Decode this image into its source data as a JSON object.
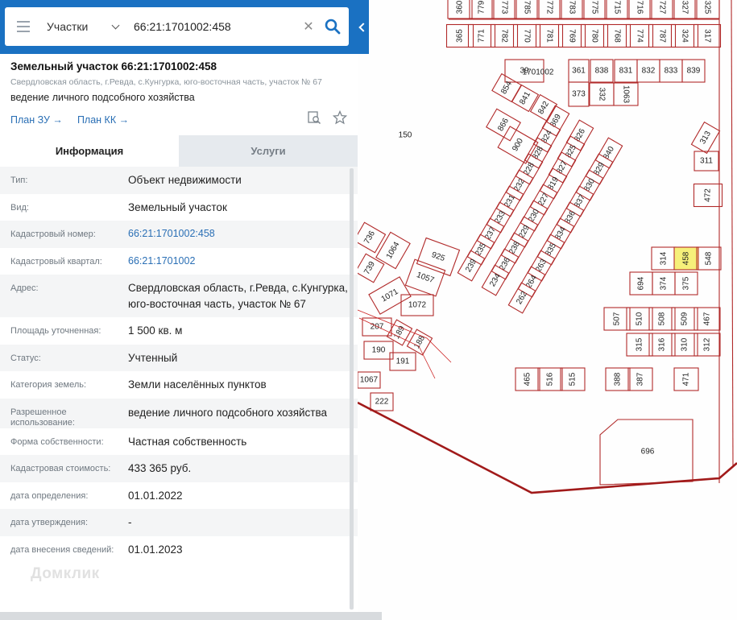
{
  "search": {
    "type_label": "Участки",
    "query": "66:21:1701002:458"
  },
  "header": {
    "title": "Земельный участок 66:21:1701002:458",
    "address_sub": "Свердловская область, г.Ревда, с.Кунгурка, юго-восточная часть, участок № 67",
    "use_sub": "ведение личного подсобного хозяйства",
    "link_plan_zu": "План ЗУ →",
    "link_plan_kk": "План КК →"
  },
  "tabs": {
    "info": "Информация",
    "services": "Услуги"
  },
  "details": [
    {
      "label": "Тип:",
      "value": "Объект недвижимости"
    },
    {
      "label": "Вид:",
      "value": "Земельный участок"
    },
    {
      "label": "Кадастровый номер:",
      "value": "66:21:1701002:458"
    },
    {
      "label": "Кадастровый квартал:",
      "value": "66:21:1701002"
    },
    {
      "label": "Адрес:",
      "value": "Свердловская область, г.Ревда, с.Кунгурка, юго-восточная часть, участок № 67"
    },
    {
      "label": "Площадь уточненная:",
      "value": "1 500 кв. м"
    },
    {
      "label": "Статус:",
      "value": "Учтенный"
    },
    {
      "label": "Категория земель:",
      "value": "Земли населённых пунктов"
    },
    {
      "label": "Разрешенное использование:",
      "value": "ведение личного подсобного хозяйства"
    },
    {
      "label": "Форма собственности:",
      "value": "Частная собственность"
    },
    {
      "label": "Кадастровая стоимость:",
      "value": "433 365 руб."
    },
    {
      "label": "дата определения:",
      "value": "01.01.2022"
    },
    {
      "label": "дата утверждения:",
      "value": "-"
    },
    {
      "label": "дата внесения сведений:",
      "value": "01.01.2023"
    }
  ],
  "watermark": "Домклик",
  "map": {
    "quarter_label": "1701002",
    "highlight_color": "#f6f07a",
    "boundary_color": "#b12a2a",
    "parcels": [
      {
        "id": "360"
      },
      {
        "id": "779"
      },
      {
        "id": "773"
      },
      {
        "id": "785"
      },
      {
        "id": "772"
      },
      {
        "id": "783"
      },
      {
        "id": "775"
      },
      {
        "id": "715"
      },
      {
        "id": "716"
      },
      {
        "id": "727"
      },
      {
        "id": "327"
      },
      {
        "id": "325"
      },
      {
        "id": "365"
      },
      {
        "id": "771"
      },
      {
        "id": "782"
      },
      {
        "id": "770"
      },
      {
        "id": "781"
      },
      {
        "id": "769"
      },
      {
        "id": "780"
      },
      {
        "id": "768"
      },
      {
        "id": "774"
      },
      {
        "id": "787"
      },
      {
        "id": "324"
      },
      {
        "id": "317"
      },
      {
        "id": "39"
      },
      {
        "id": "361"
      },
      {
        "id": "838"
      },
      {
        "id": "831"
      },
      {
        "id": "832"
      },
      {
        "id": "833"
      },
      {
        "id": "839"
      },
      {
        "id": "373"
      },
      {
        "id": "332"
      },
      {
        "id": "1063"
      },
      {
        "id": "854"
      },
      {
        "id": "841"
      },
      {
        "id": "842"
      },
      {
        "id": "866"
      },
      {
        "id": "900"
      },
      {
        "id": "869"
      },
      {
        "id": "826"
      },
      {
        "id": "824"
      },
      {
        "id": "825"
      },
      {
        "id": "828"
      },
      {
        "id": "827"
      },
      {
        "id": "228"
      },
      {
        "id": "819"
      },
      {
        "id": "840"
      },
      {
        "id": "829"
      },
      {
        "id": "830"
      },
      {
        "id": "232"
      },
      {
        "id": "227"
      },
      {
        "id": "231"
      },
      {
        "id": "230"
      },
      {
        "id": "837"
      },
      {
        "id": "836"
      },
      {
        "id": "233"
      },
      {
        "id": "229"
      },
      {
        "id": "834"
      },
      {
        "id": "237"
      },
      {
        "id": "238"
      },
      {
        "id": "835"
      },
      {
        "id": "235"
      },
      {
        "id": "236"
      },
      {
        "id": "263"
      },
      {
        "id": "239"
      },
      {
        "id": "234"
      },
      {
        "id": "264"
      },
      {
        "id": "262"
      },
      {
        "id": "150"
      },
      {
        "id": "313"
      },
      {
        "id": "311"
      },
      {
        "id": "472"
      },
      {
        "id": "314"
      },
      {
        "id": "458"
      },
      {
        "id": "548"
      },
      {
        "id": "694"
      },
      {
        "id": "374"
      },
      {
        "id": "375"
      },
      {
        "id": "507"
      },
      {
        "id": "510"
      },
      {
        "id": "508"
      },
      {
        "id": "509"
      },
      {
        "id": "467"
      },
      {
        "id": "315"
      },
      {
        "id": "316"
      },
      {
        "id": "310"
      },
      {
        "id": "312"
      },
      {
        "id": "465"
      },
      {
        "id": "516"
      },
      {
        "id": "515"
      },
      {
        "id": "388"
      },
      {
        "id": "387"
      },
      {
        "id": "471"
      },
      {
        "id": "696"
      },
      {
        "id": "736"
      },
      {
        "id": "1064"
      },
      {
        "id": "925"
      },
      {
        "id": "739"
      },
      {
        "id": "1057"
      },
      {
        "id": "1071"
      },
      {
        "id": "1072"
      },
      {
        "id": "207"
      },
      {
        "id": "189"
      },
      {
        "id": "188"
      },
      {
        "id": "190"
      },
      {
        "id": "191"
      },
      {
        "id": "1067"
      },
      {
        "id": "222"
      }
    ]
  }
}
